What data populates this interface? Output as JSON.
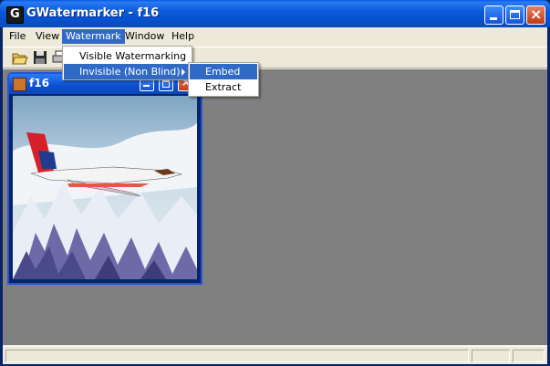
{
  "window": {
    "title": "GWatermarker - f16"
  },
  "menubar": {
    "items": [
      {
        "label": "File"
      },
      {
        "label": "View"
      },
      {
        "label": "Watermark"
      },
      {
        "label": "Window"
      },
      {
        "label": "Help"
      }
    ]
  },
  "toolbar": {
    "icons": [
      "open-folder-icon",
      "save-disk-icon",
      "print-icon"
    ]
  },
  "watermark_menu": {
    "items": [
      {
        "label": "Visible Watermarking"
      },
      {
        "label": "Invisible (Non Blind)",
        "has_submenu": true
      }
    ]
  },
  "submenu": {
    "items": [
      {
        "label": "Embed"
      },
      {
        "label": "Extract"
      }
    ]
  },
  "child_window": {
    "title": "f16"
  },
  "colors": {
    "titlebar": "#0A58E6",
    "menu_highlight": "#316AC5",
    "mdi_background": "#808080",
    "chrome": "#ECE9D8"
  }
}
